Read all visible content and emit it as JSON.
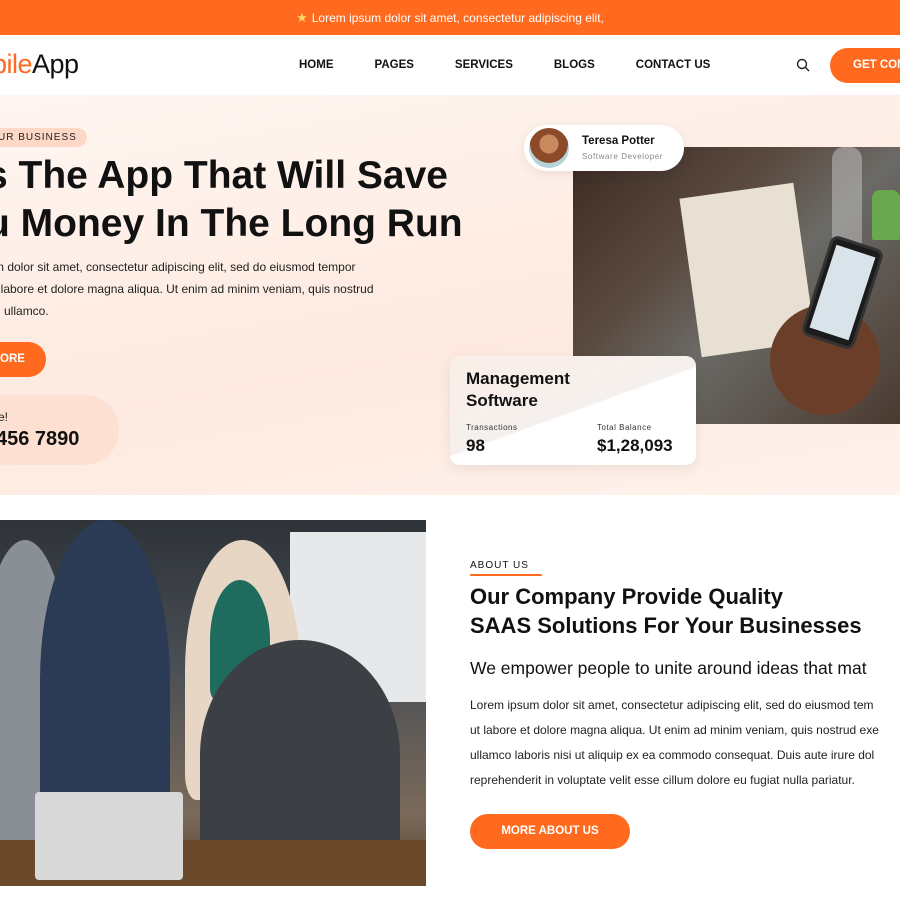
{
  "announcement": {
    "icon": "star-icon",
    "text": "Lorem ipsum dolor sit amet, consectetur adipiscing elit,"
  },
  "header": {
    "logo_accent": "bile",
    "logo_rest": "App",
    "nav": [
      "HOME",
      "PAGES",
      "SERVICES",
      "BLOGS",
      "CONTACT US"
    ],
    "search_icon": "search-icon",
    "cta_label": "GET CON"
  },
  "hero": {
    "pill": "UR BUSINESS",
    "title_line1": "s The App That Will Save",
    "title_line2": "u Money In The Long Run",
    "paragraph_lines": [
      "m dolor sit amet, consectetur adipiscing elit, sed do eiusmod tempor",
      "t labore et dolore magna aliqua. Ut enim ad minim veniam, quis nostrud",
      "n ullamco."
    ],
    "more_button": "ORE",
    "phone_label": "e!",
    "phone_number": "456 7890",
    "profile": {
      "name": "Teresa Potter",
      "role": "Software Developer"
    },
    "stats_card": {
      "title_line1": "Management",
      "title_line2": "Software",
      "transactions_label": "Transactions",
      "transactions_value": "98",
      "balance_label": "Total Balance",
      "balance_value": "$1,28,093"
    }
  },
  "about": {
    "label": "ABOUT US",
    "title_line1": "Our Company Provide Quality",
    "title_line2": "SAAS Solutions For Your Businesses",
    "subtitle": "We empower people to unite around ideas that mat",
    "paragraph_lines": [
      "Lorem ipsum dolor sit amet, consectetur adipiscing elit, sed do eiusmod tem",
      "ut labore et dolore magna aliqua. Ut enim ad minim veniam, quis nostrud exe",
      "ullamco laboris nisi ut aliquip ex ea commodo consequat. Duis aute irure dol",
      "reprehenderit in voluptate velit esse cillum dolore eu fugiat nulla pariatur."
    ],
    "button": "MORE ABOUT US"
  },
  "colors": {
    "accent": "#ff6a1f",
    "hero_bg": "#fdeee6",
    "pill_bg": "#fdd8c6"
  }
}
